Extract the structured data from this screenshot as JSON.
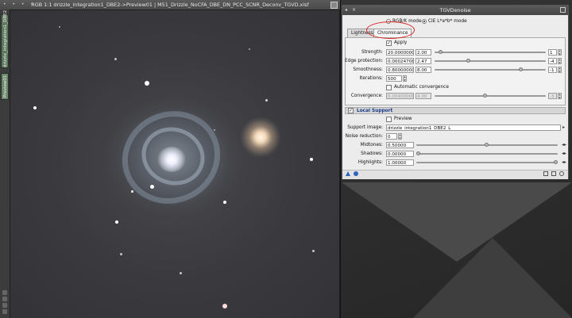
{
  "image_window": {
    "title": "RGB 1:1 drizzle_integration1_DBE2->Preview01 | M51_Drizzle_NoCFA_DBE_DN_PCC_SCNR_Deconv_TGVD.xisf",
    "dots": "• • • •",
    "side_tabs": [
      "drizzle_integration1_DBE2",
      "Preview01"
    ]
  },
  "dialog": {
    "title": "TGVDenoise",
    "title_left": "◂",
    "title_left2": "×",
    "modes": {
      "rgb": "RGB/K mode",
      "lab": "CIE L*a*b* mode",
      "selected": "lab"
    },
    "tabs": [
      {
        "label": "Lightness",
        "active": false
      },
      {
        "label": "Chrominance",
        "active": true
      }
    ],
    "apply": {
      "label": "Apply",
      "checked": true
    },
    "strength": {
      "label": "Strength:",
      "value": "20.0000000",
      "exp": "2.00",
      "spin": "1",
      "slider": 0.05
    },
    "edge": {
      "label": "Edge protection:",
      "value": "0.00024708",
      "exp": "2.47",
      "spin": "-4",
      "slider": 0.3
    },
    "smooth": {
      "label": "Smoothness:",
      "value": "0.80000000",
      "exp": "8.00",
      "spin": "-1",
      "slider": 0.78
    },
    "iterations": {
      "label": "Iterations:",
      "value": "500"
    },
    "auto_conv": {
      "label": "Automatic convergence",
      "checked": false
    },
    "convergence": {
      "label": "Convergence:",
      "value": "0.00400000",
      "exp": "4.00",
      "spin": "-3",
      "slider": 0.45
    },
    "local_support": {
      "label": "Local Support",
      "checked": true,
      "preview": {
        "label": "Preview",
        "checked": false
      },
      "support_image": {
        "label": "Support image:",
        "value": "drizzle_integration1_DBE2_L"
      },
      "noise_reduction": {
        "label": "Noise reduction:",
        "value": "0"
      },
      "midtones": {
        "label": "Midtones:",
        "value": "0.50000",
        "slider": 0.5
      },
      "shadows": {
        "label": "Shadows:",
        "value": "0.00000",
        "slider": 0.0
      },
      "highlights": {
        "label": "Highlights:",
        "value": "1.00000",
        "slider": 1.0
      }
    }
  }
}
